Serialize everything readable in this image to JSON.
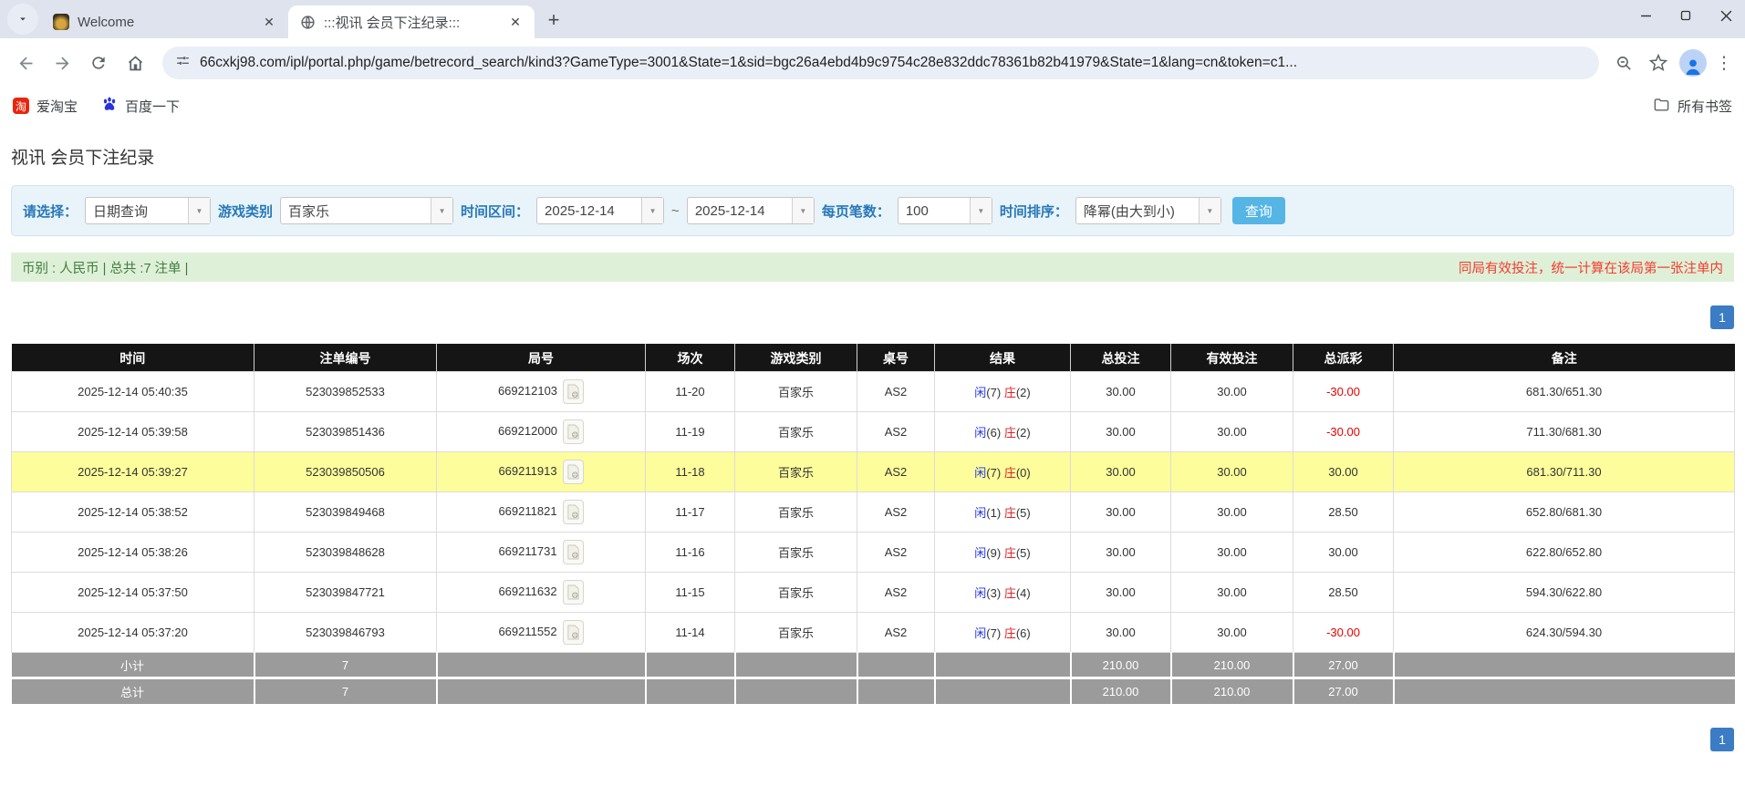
{
  "browser": {
    "tabs": [
      {
        "title": "Welcome"
      },
      {
        "title": ":::视讯 会员下注纪录:::",
        "active": true
      }
    ],
    "url": "66cxkj98.com/ipl/portal.php/game/betrecord_search/kind3?GameType=3001&State=1&sid=bgc26a4ebd4b9c9754c28e832ddc78361b82b41979&State=1&lang=cn&token=c1...",
    "bookmarks": [
      {
        "label": "爱淘宝"
      },
      {
        "label": "百度一下"
      }
    ],
    "bookmarks_right": "所有书签"
  },
  "icons": {
    "close": "✕",
    "plus": "+",
    "kebab": "⋮",
    "dropdown_arrow": "▼",
    "taobao_glyph": "淘"
  },
  "page": {
    "title": "视讯 会员下注纪录",
    "filter": {
      "select_label": "请选择：",
      "select_value": "日期查询",
      "game_type_label": "游戏类别",
      "game_type_value": "百家乐",
      "time_range_label": "时间区间：",
      "date_from": "2025-12-14",
      "tilde": "~",
      "date_to": "2025-12-14",
      "page_size_label": "每页笔数：",
      "page_size_value": "100",
      "sort_label": "时间排序：",
      "sort_value": "降幂(由大到小)",
      "search_button": "查询"
    },
    "info_bar": {
      "left": "币别 : 人民币 | 总共 :7 注单 |",
      "right": "同局有效投注，统一计算在该局第一张注单内"
    },
    "pagination": "1",
    "table": {
      "headers": [
        "时间",
        "注单编号",
        "局号",
        "场次",
        "游戏类别",
        "桌号",
        "结果",
        "总投注",
        "有效投注",
        "总派彩",
        "备注"
      ],
      "rows": [
        {
          "time": "2025-12-14 05:40:35",
          "bet_id": "523039852533",
          "round_id": "669212103",
          "session": "11-20",
          "game": "百家乐",
          "table_no": "AS2",
          "player": "闲",
          "player_n": "(7)",
          "banker": "庄",
          "banker_n": "(2)",
          "total_bet": "30.00",
          "valid_bet": "30.00",
          "payout": "-30.00",
          "note": "681.30/651.30",
          "highlighted": false
        },
        {
          "time": "2025-12-14 05:39:58",
          "bet_id": "523039851436",
          "round_id": "669212000",
          "session": "11-19",
          "game": "百家乐",
          "table_no": "AS2",
          "player": "闲",
          "player_n": "(6)",
          "banker": "庄",
          "banker_n": "(2)",
          "total_bet": "30.00",
          "valid_bet": "30.00",
          "payout": "-30.00",
          "note": "711.30/681.30",
          "highlighted": false
        },
        {
          "time": "2025-12-14 05:39:27",
          "bet_id": "523039850506",
          "round_id": "669211913",
          "session": "11-18",
          "game": "百家乐",
          "table_no": "AS2",
          "player": "闲",
          "player_n": "(7)",
          "banker": "庄",
          "banker_n": "(0)",
          "total_bet": "30.00",
          "valid_bet": "30.00",
          "payout": "30.00",
          "note": "681.30/711.30",
          "highlighted": true
        },
        {
          "time": "2025-12-14 05:38:52",
          "bet_id": "523039849468",
          "round_id": "669211821",
          "session": "11-17",
          "game": "百家乐",
          "table_no": "AS2",
          "player": "闲",
          "player_n": "(1)",
          "banker": "庄",
          "banker_n": "(5)",
          "total_bet": "30.00",
          "valid_bet": "30.00",
          "payout": "28.50",
          "note": "652.80/681.30",
          "highlighted": false
        },
        {
          "time": "2025-12-14 05:38:26",
          "bet_id": "523039848628",
          "round_id": "669211731",
          "session": "11-16",
          "game": "百家乐",
          "table_no": "AS2",
          "player": "闲",
          "player_n": "(9)",
          "banker": "庄",
          "banker_n": "(5)",
          "total_bet": "30.00",
          "valid_bet": "30.00",
          "payout": "30.00",
          "note": "622.80/652.80",
          "highlighted": false
        },
        {
          "time": "2025-12-14 05:37:50",
          "bet_id": "523039847721",
          "round_id": "669211632",
          "session": "11-15",
          "game": "百家乐",
          "table_no": "AS2",
          "player": "闲",
          "player_n": "(3)",
          "banker": "庄",
          "banker_n": "(4)",
          "total_bet": "30.00",
          "valid_bet": "30.00",
          "payout": "28.50",
          "note": "594.30/622.80",
          "highlighted": false
        },
        {
          "time": "2025-12-14 05:37:20",
          "bet_id": "523039846793",
          "round_id": "669211552",
          "session": "11-14",
          "game": "百家乐",
          "table_no": "AS2",
          "player": "闲",
          "player_n": "(7)",
          "banker": "庄",
          "banker_n": "(6)",
          "total_bet": "30.00",
          "valid_bet": "30.00",
          "payout": "-30.00",
          "note": "624.30/594.30",
          "highlighted": false
        }
      ],
      "subtotal": {
        "label": "小计",
        "count": "7",
        "total_bet": "210.00",
        "valid_bet": "210.00",
        "payout": "27.00"
      },
      "total": {
        "label": "总计",
        "count": "7",
        "total_bet": "210.00",
        "valid_bet": "210.00",
        "payout": "27.00"
      }
    }
  }
}
